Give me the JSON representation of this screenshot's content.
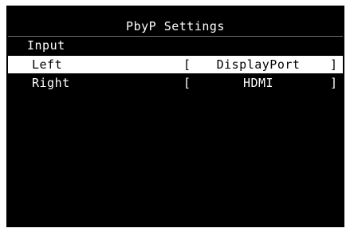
{
  "window": {
    "title": "PbyP Settings"
  },
  "section": {
    "label": "Input"
  },
  "items": [
    {
      "label": "Left",
      "bracket_open": "[",
      "value": "DisplayPort",
      "bracket_close": "]",
      "selected": true
    },
    {
      "label": "Right",
      "bracket_open": "[",
      "value": "HDMI",
      "bracket_close": "]",
      "selected": false
    }
  ],
  "colors": {
    "background": "#000000",
    "text": "#ffffff",
    "highlight": "#ffffff",
    "highlight_text": "#000000",
    "divider": "#6e6e6e"
  }
}
